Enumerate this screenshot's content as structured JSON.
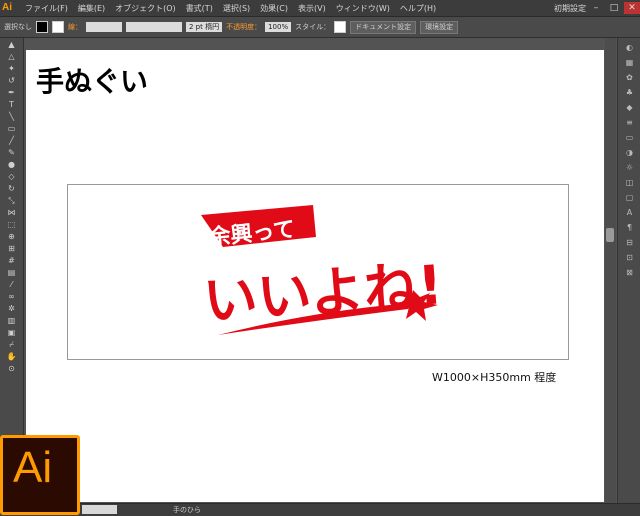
{
  "app": {
    "logo": "Ai",
    "workspace": "初期設定"
  },
  "menu": {
    "items": [
      "ファイル(F)",
      "編集(E)",
      "オブジェクト(O)",
      "書式(T)",
      "選択(S)",
      "効果(C)",
      "表示(V)",
      "ウィンドウ(W)",
      "ヘルプ(H)"
    ]
  },
  "control": {
    "selection": "選択なし",
    "stroke_label": "線：",
    "stroke_weight": "2 pt 楕円",
    "opacity_label": "不透明度：",
    "opacity_value": "100%",
    "style_label": "スタイル：",
    "doc_setup": "ドキュメント設定",
    "prefs": "環境設定"
  },
  "document": {
    "title": "手ぬぐい",
    "size_note": "W1000×H350mm 程度"
  },
  "design": {
    "flag_text": "余興って",
    "main_text": "いいよね!",
    "red": "#e10b17"
  },
  "status": {
    "tool": "手のひら"
  },
  "dock_icon": {
    "label": "Ai",
    "accent": "#ff9a00"
  }
}
